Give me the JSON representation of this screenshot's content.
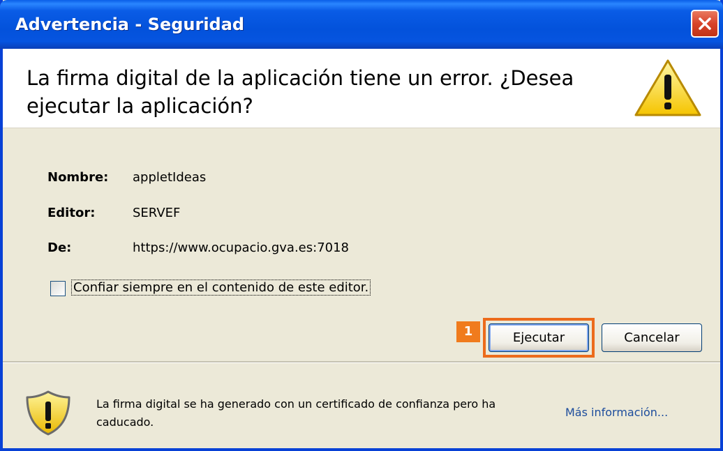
{
  "window": {
    "title": "Advertencia - Seguridad",
    "close_icon": "close-icon"
  },
  "header": {
    "question": "La firma digital de la aplicación tiene un error.  ¿Desea ejecutar la aplicación?",
    "icon": "warning-triangle-icon"
  },
  "details": {
    "name_label": "Nombre:",
    "name_value": "appletIdeas",
    "editor_label": "Editor:",
    "editor_value": "SERVEF",
    "from_label": "De:",
    "from_value": "https://www.ocupacio.gva.es:7018",
    "trust_checkbox_label": "Confiar siempre en el contenido de este editor.",
    "trust_checked": false
  },
  "buttons": {
    "step_badge": "1",
    "run_label": "Ejecutar",
    "cancel_label": "Cancelar"
  },
  "footer": {
    "icon": "warning-shield-icon",
    "message": "La firma digital se ha generado con un certificado de confianza pero ha caducado.",
    "more_info_link": "Más información..."
  },
  "colors": {
    "title_bar": "#0352db",
    "dialog_body": "#ece9d8",
    "highlight": "#ec6b1b",
    "badge": "#f07b1d",
    "link": "#1c4c9c"
  }
}
